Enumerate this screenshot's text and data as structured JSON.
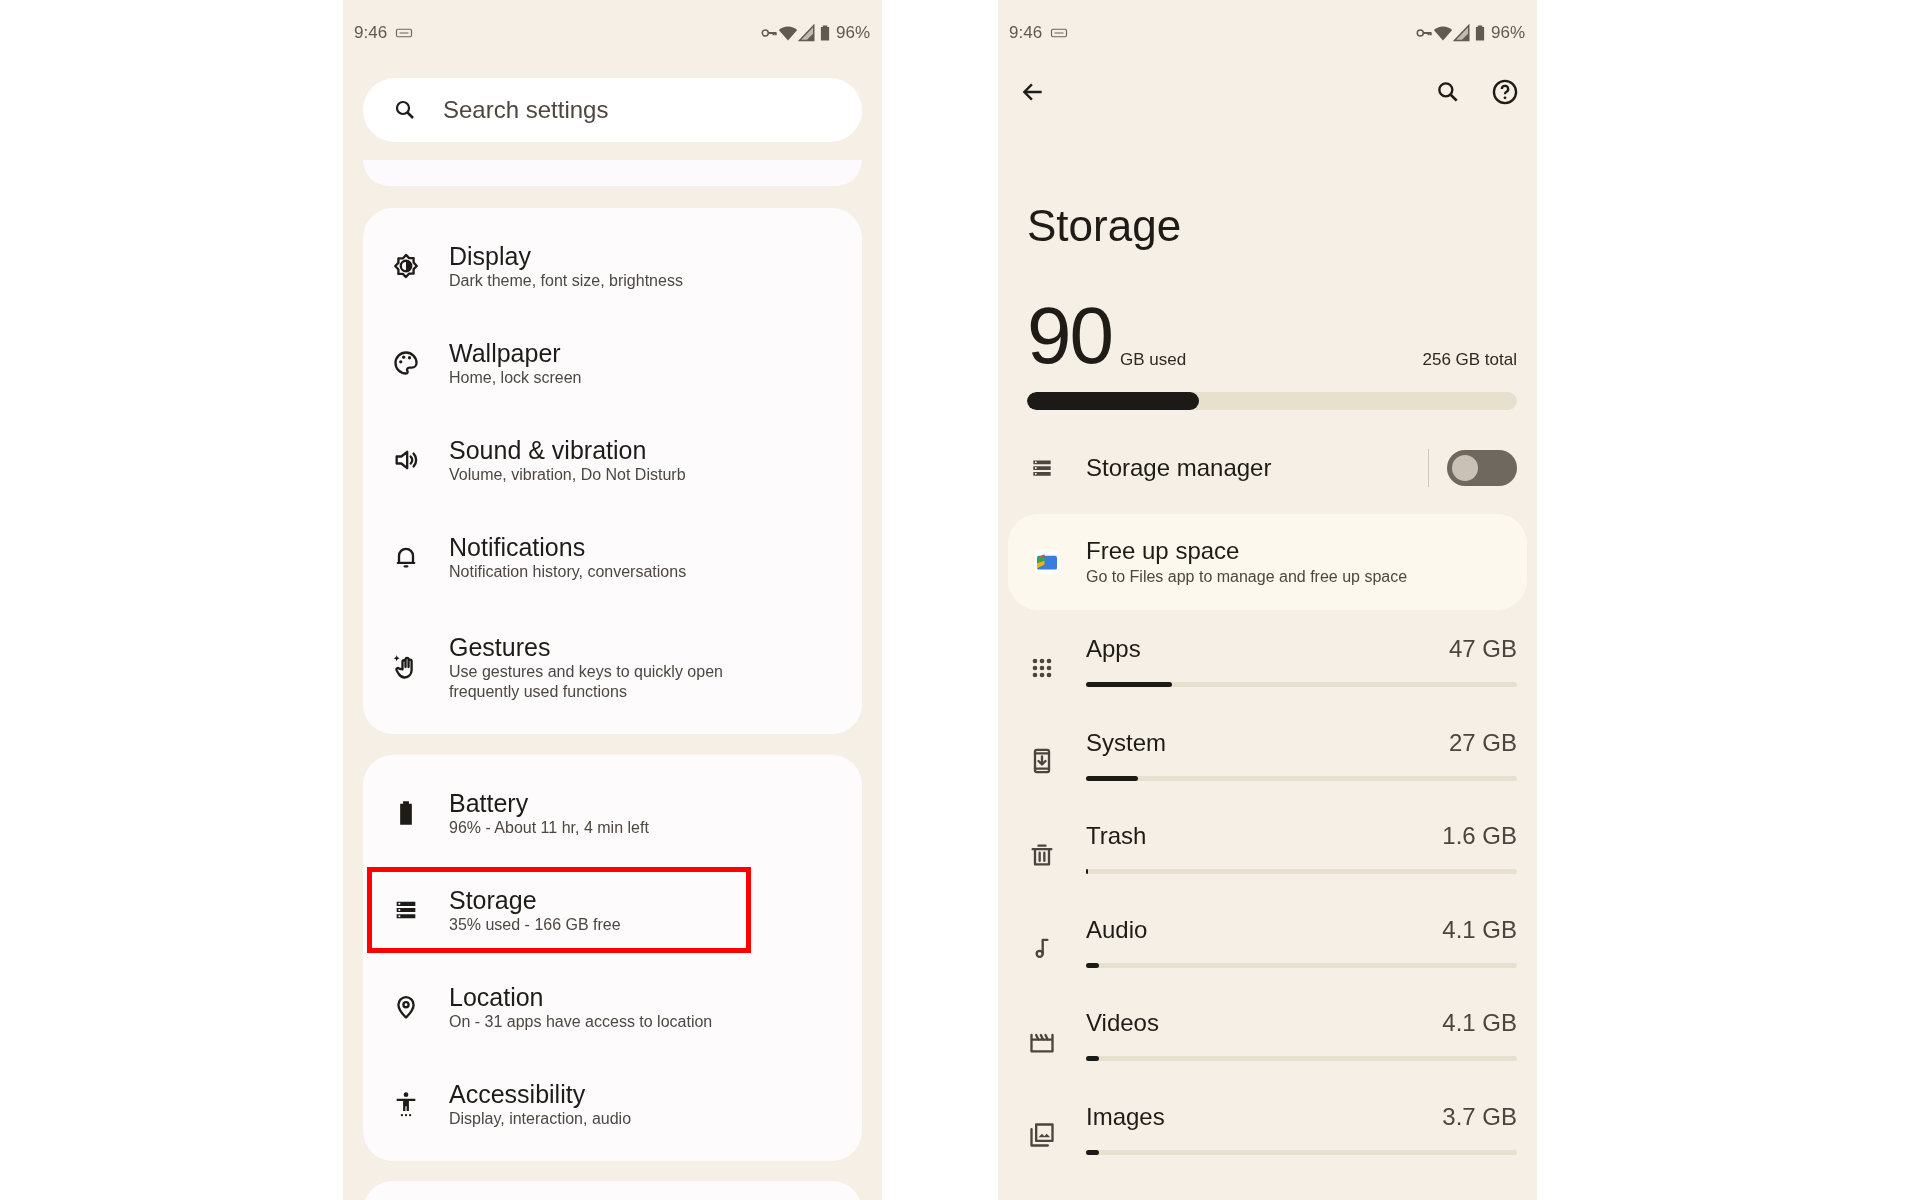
{
  "left": {
    "status_bar": {
      "time": "9:46",
      "battery": "96%"
    },
    "search": {
      "placeholder": "Search settings"
    },
    "cards": [
      {
        "items": [
          {
            "title": "Display",
            "subtitle": "Dark theme, font size, brightness",
            "highlighted": false
          },
          {
            "title": "Wallpaper",
            "subtitle": "Home, lock screen",
            "highlighted": false
          },
          {
            "title": "Sound & vibration",
            "subtitle": "Volume, vibration, Do Not Disturb",
            "highlighted": false
          },
          {
            "title": "Notifications",
            "subtitle": "Notification history, conversations",
            "highlighted": false
          },
          {
            "title": "Gestures",
            "subtitle": "Use gestures and keys to quickly open frequently used functions",
            "highlighted": false
          }
        ]
      },
      {
        "items": [
          {
            "title": "Battery",
            "subtitle": "96% - About 11 hr, 4 min left",
            "highlighted": false
          },
          {
            "title": "Storage",
            "subtitle": "35% used - 166 GB free",
            "highlighted": true
          },
          {
            "title": "Location",
            "subtitle": "On - 31 apps have access to location",
            "highlighted": false
          },
          {
            "title": "Accessibility",
            "subtitle": "Display, interaction, audio",
            "highlighted": false
          }
        ]
      }
    ]
  },
  "right": {
    "status_bar": {
      "time": "9:46",
      "battery": "96%"
    },
    "title": "Storage",
    "usage": {
      "used": "90",
      "used_unit": "GB used",
      "total": "256 GB total",
      "level": 0.35
    },
    "storage_manager": {
      "label": "Storage manager",
      "on": false
    },
    "free_up": {
      "title": "Free up space",
      "subtitle": "Go to Files app to manage and free up space"
    },
    "categories": [
      {
        "name": "Apps",
        "size": "47 GB",
        "level": 0.2
      },
      {
        "name": "System",
        "size": "27 GB",
        "level": 0.12
      },
      {
        "name": "Trash",
        "size": "1.6 GB",
        "level": 0.005
      },
      {
        "name": "Audio",
        "size": "4.1 GB",
        "level": 0.03
      },
      {
        "name": "Videos",
        "size": "4.1 GB",
        "level": 0.03
      },
      {
        "name": "Images",
        "size": "3.7 GB",
        "level": 0.03
      }
    ]
  }
}
